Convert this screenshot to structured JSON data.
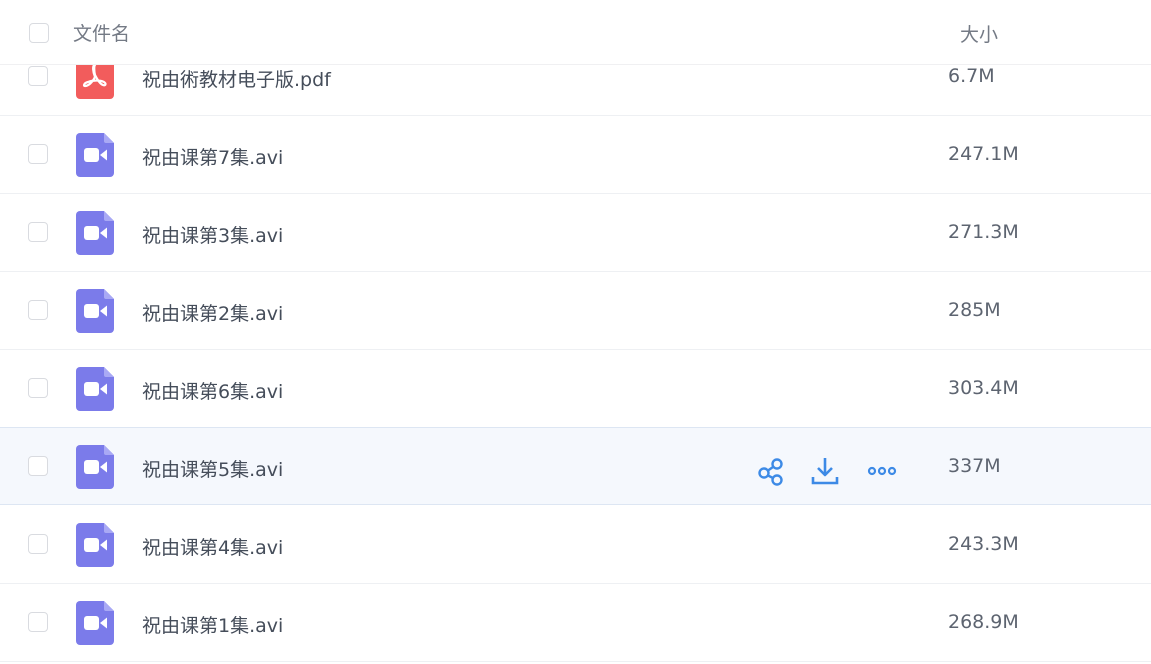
{
  "header": {
    "name_label": "文件名",
    "size_label": "大小"
  },
  "colors": {
    "pdf_icon": "#f25c5c",
    "video_icon": "#7b7bea",
    "action_icon": "#3d8ae6",
    "hover_row": "#f5f8fd"
  },
  "files": [
    {
      "name": "祝由術教材电子版.pdf",
      "size": "6.7M",
      "type": "pdf-icon"
    },
    {
      "name": "祝由课第7集.avi",
      "size": "247.1M",
      "type": "video-icon"
    },
    {
      "name": "祝由课第3集.avi",
      "size": "271.3M",
      "type": "video-icon"
    },
    {
      "name": "祝由课第2集.avi",
      "size": "285M",
      "type": "video-icon"
    },
    {
      "name": "祝由课第6集.avi",
      "size": "303.4M",
      "type": "video-icon"
    },
    {
      "name": "祝由课第5集.avi",
      "size": "337M",
      "type": "video-icon",
      "hovered": true
    },
    {
      "name": "祝由课第4集.avi",
      "size": "243.3M",
      "type": "video-icon"
    },
    {
      "name": "祝由课第1集.avi",
      "size": "268.9M",
      "type": "video-icon"
    }
  ],
  "row_actions": [
    "share-icon",
    "download-icon",
    "more-icon"
  ]
}
